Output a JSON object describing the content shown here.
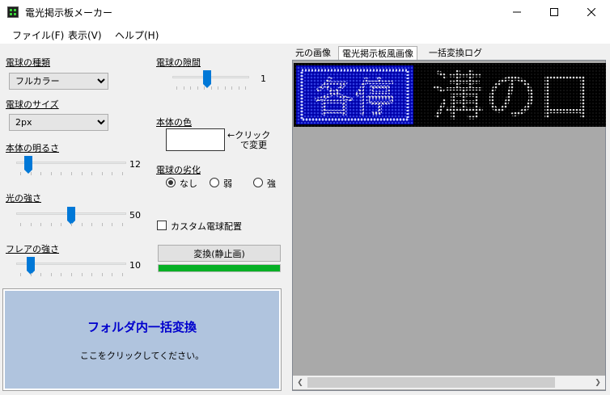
{
  "window": {
    "title": "電光掲示板メーカー",
    "minimize_glyph": "—",
    "maximize_glyph": "☐",
    "close_glyph": "✕"
  },
  "menu": [
    "ファイル(F)",
    "表示(V)",
    "ヘルプ(H)"
  ],
  "left": {
    "bulb_type": {
      "label": "電球の種類",
      "value": "フルカラー"
    },
    "bulb_size": {
      "label": "電球のサイズ",
      "value": "2px"
    },
    "body_brightness": {
      "label": "本体の明るさ",
      "value": "12",
      "fraction": 0.08
    },
    "light_strength": {
      "label": "光の強さ",
      "value": "50",
      "fraction": 0.5
    },
    "flare_strength": {
      "label": "フレアの強さ",
      "value": "10",
      "fraction": 0.1
    },
    "bulb_gap": {
      "label": "電球の隙間",
      "value": "1",
      "fraction": 0.45
    },
    "body_color": {
      "label": "本体の色",
      "hint_line1": "←クリック",
      "hint_line2": "で変更",
      "color": "#ffffff"
    },
    "degradation": {
      "label": "電球の劣化",
      "options": [
        "なし",
        "弱",
        "強"
      ],
      "selected": "なし"
    },
    "custom_layout": {
      "label": "カスタム電球配置",
      "checked": false
    },
    "convert_button": "変換(静止画)",
    "progress": 1.0,
    "batch": {
      "title": "フォルダ内一括変換",
      "subtitle": "ここをクリックしてください。"
    }
  },
  "tabs": [
    "元の画像",
    "電光掲示板風画像",
    "一括変換ログ"
  ],
  "active_tab": "電光掲示板風画像",
  "led": {
    "text": "各停 溝の口",
    "badge_text": "各停",
    "main_text": "溝の口"
  },
  "colors": {
    "accent": "#0078d7",
    "progress": "#06b025",
    "batch_bg": "#b0c4de",
    "batch_title": "#0000cd"
  }
}
